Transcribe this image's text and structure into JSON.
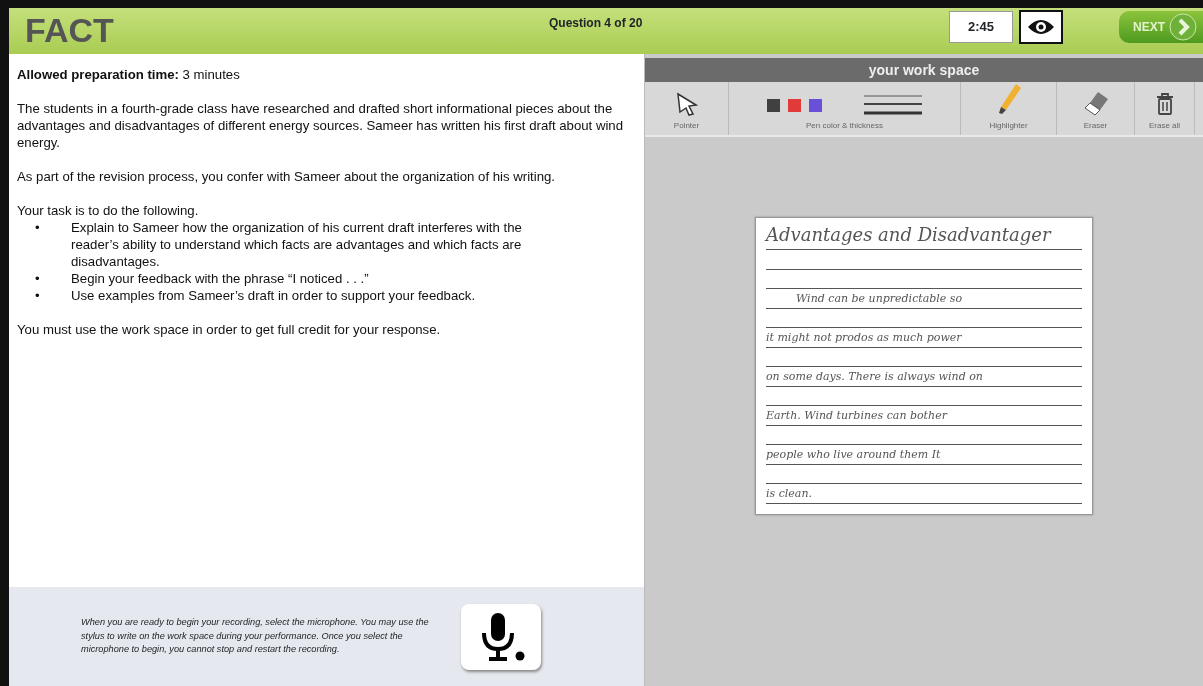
{
  "header": {
    "logo": "FACT",
    "question": "Question 4 of 20",
    "timer": "2:45",
    "next": "NEXT"
  },
  "prompt": {
    "prep_label": "Allowed preparation time:",
    "prep_value": "3 minutes",
    "paragraphs": [
      "The students in a fourth-grade class have researched and drafted short informational pieces about the advantages and disadvantages of different energy sources. Sameer has written his first draft about wind energy.",
      "As part of the revision process, you confer with Sameer about the organization of his writing."
    ],
    "task_intro": "Your task is to do the following.",
    "bullets": [
      {
        "marker": "•",
        "text": "Explain to Sameer how the organization of his current draft interferes with the reader’s ability to understand which facts are advantages and which facts are disadvantages."
      },
      {
        "marker": "•",
        "text": "Begin your feedback with the phrase “I noticed . . .”"
      },
      {
        "marker": "•",
        "text": "Use examples from Sameer’s draft in order to support your feedback."
      }
    ],
    "closing": "You must use the work space in order to get full credit for your response."
  },
  "recording": {
    "instructions": "When you are ready to begin your recording, select the microphone. You may use the stylus to write on the work space during your performance. Once you select the microphone to begin, you cannot stop and restart the recording."
  },
  "workspace": {
    "title": "your work space",
    "tools": [
      {
        "kind": "pointer",
        "label": "Pointer"
      },
      {
        "kind": "pen",
        "label": "Pen color & thickness",
        "swatches": [
          {
            "color": "#404040"
          },
          {
            "color": "#e03a3a"
          },
          {
            "color": "#6a4fd8"
          }
        ]
      },
      {
        "kind": "highlighter",
        "label": "Highlighter"
      },
      {
        "kind": "eraser",
        "label": "Eraser"
      },
      {
        "kind": "trash",
        "label": "Erase all"
      }
    ],
    "draft": {
      "title": "Advantages and Disadvantager",
      "lines": [
        "Wind can be unpredictable so",
        "it might not prodos as much power",
        "on some days. There is always wind on",
        "Earth. Wind turbines can bother",
        "people who live around them It",
        "is clean."
      ]
    }
  }
}
